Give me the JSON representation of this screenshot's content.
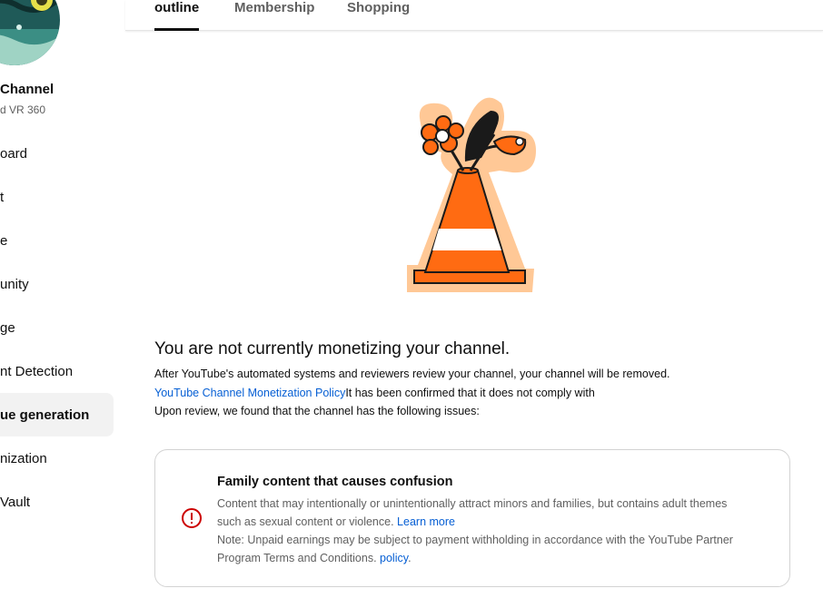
{
  "sidebar": {
    "channel_name": "Channel",
    "channel_sub": "d VR 360",
    "items": [
      {
        "label": "oard"
      },
      {
        "label": "t"
      },
      {
        "label": "e"
      },
      {
        "label": "unity"
      },
      {
        "label": "ge"
      },
      {
        "label": "nt Detection"
      },
      {
        "label": "ue generation"
      },
      {
        "label": "nization"
      },
      {
        "label": "Vault"
      }
    ],
    "active_index": 6
  },
  "tabs": [
    {
      "label": "outline"
    },
    {
      "label": "Membership"
    },
    {
      "label": "Shopping"
    }
  ],
  "main": {
    "headline": "You are not currently monetizing your channel.",
    "line1": "After YouTube's automated systems and reviewers review your channel, your channel will be removed.",
    "policy_link": "YouTube Channel Monetization Policy",
    "line2_rest": "It has been confirmed that it does not comply with",
    "line3": "Upon review, we found that the channel has the following issues:"
  },
  "issue_card": {
    "title": "Family content that causes confusion",
    "desc1": "Content that may intentionally or unintentionally attract minors and families, but contains adult themes",
    "desc2": "such as sexual content or violence.",
    "learn_more": "Learn more",
    "note1": "Note: Unpaid earnings may be subject to payment withholding in accordance with the YouTube Partner",
    "note2": "Program Terms and Conditions.",
    "policy": "policy",
    "note2_end": "."
  },
  "colors": {
    "link": "#065fd4",
    "warning": "#cc0000",
    "cone_orange": "#ff6b12",
    "cone_halo": "#ffc896"
  }
}
